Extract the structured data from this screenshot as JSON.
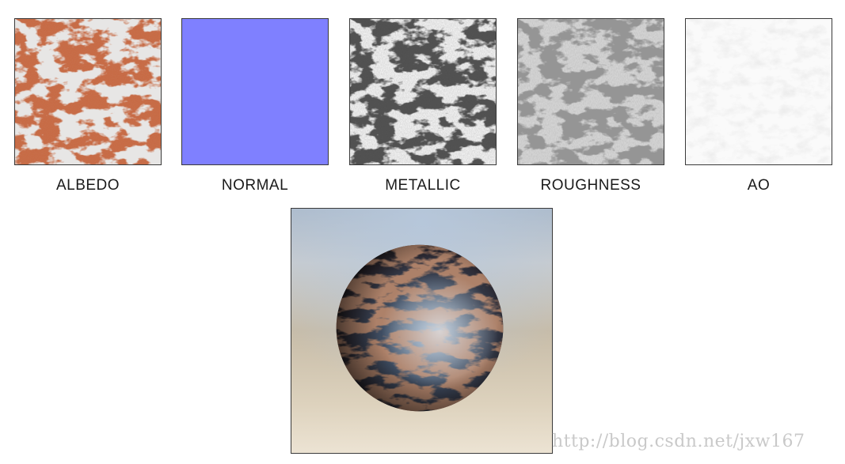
{
  "maps": [
    {
      "label": "ALBEDO",
      "color": "#c8663f"
    },
    {
      "label": "NORMAL",
      "color": "#7f80ff"
    },
    {
      "label": "METALLIC",
      "color": "#ffffff"
    },
    {
      "label": "ROUGHNESS",
      "color": "#cfcfcf"
    },
    {
      "label": "AO",
      "color": "#f6f6f6"
    }
  ],
  "render": {
    "subject": "rusted-metal-sphere"
  },
  "watermark": "http://blog.csdn.net/jxw167"
}
